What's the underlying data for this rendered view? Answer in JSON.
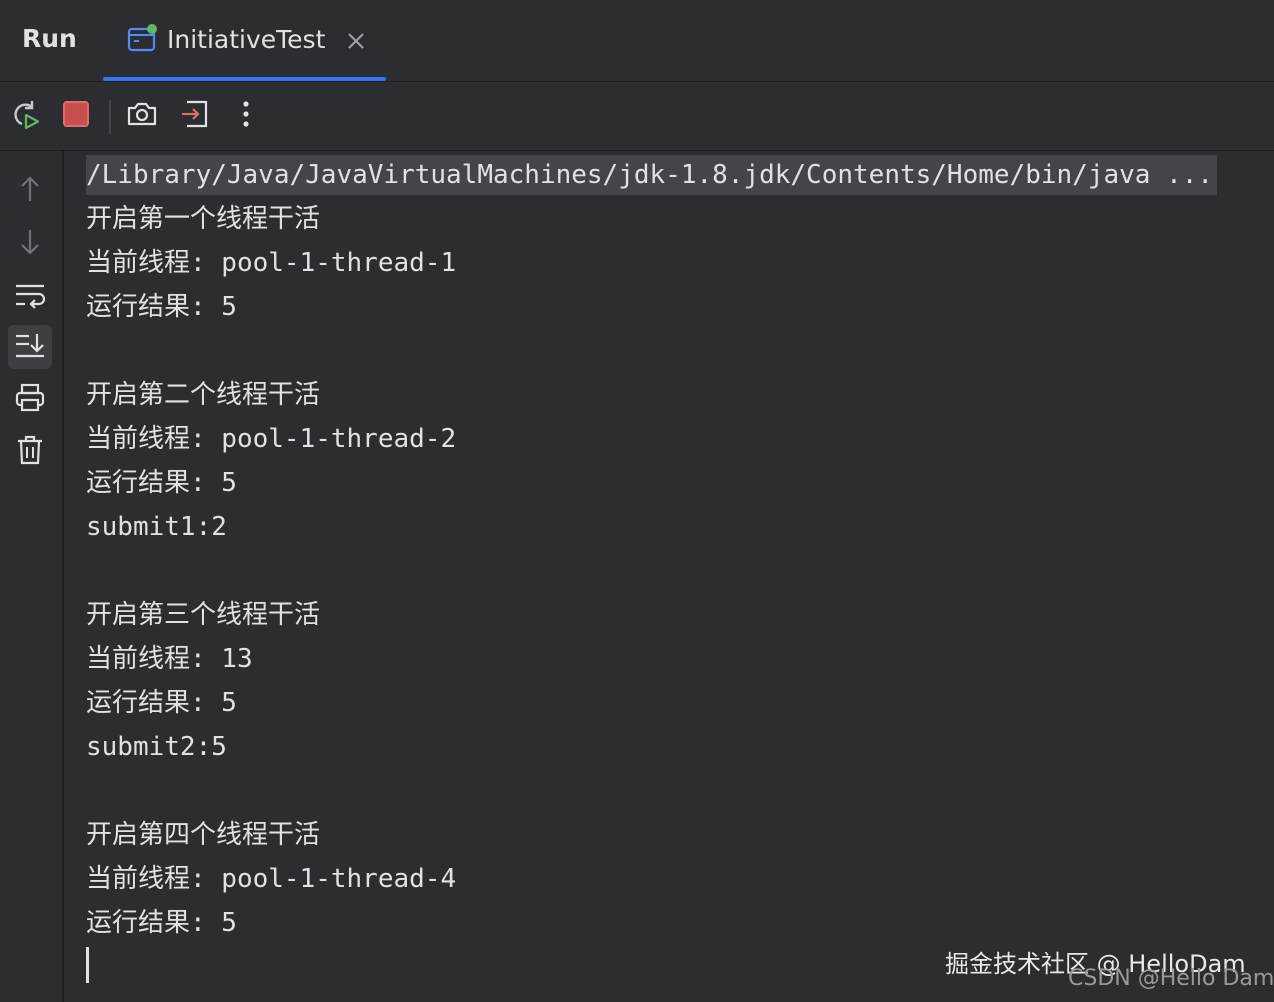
{
  "header": {
    "title": "Run",
    "tab_label": "InitiativeTest"
  },
  "colors": {
    "background": "#2b2d30",
    "text": "#dfe1e5",
    "accent": "#3574f0",
    "stop_red": "#c94f4f",
    "run_green": "#5fb865"
  },
  "toolbar": {
    "icons": [
      "rerun-icon",
      "stop-icon",
      "camera-icon",
      "exit-icon",
      "more-icon"
    ]
  },
  "gutter": {
    "icons": [
      "arrow-up-icon",
      "arrow-down-icon",
      "soft-wrap-icon",
      "scroll-to-end-icon",
      "print-icon",
      "trash-icon"
    ]
  },
  "console": {
    "lines": [
      "/Library/Java/JavaVirtualMachines/jdk-1.8.jdk/Contents/Home/bin/java ...",
      "开启第一个线程干活",
      "当前线程: pool-1-thread-1",
      "运行结果: 5",
      "",
      "开启第二个线程干活",
      "当前线程: pool-1-thread-2",
      "运行结果: 5",
      "submit1:2",
      "",
      "开启第三个线程干活",
      "当前线程: 13",
      "运行结果: 5",
      "submit2:5",
      "",
      "开启第四个线程干活",
      "当前线程: pool-1-thread-4",
      "运行结果: 5"
    ]
  },
  "watermark": {
    "line1": "掘金技术社区 @ HelloDam",
    "line2": "CSDN @Hello Dam"
  }
}
